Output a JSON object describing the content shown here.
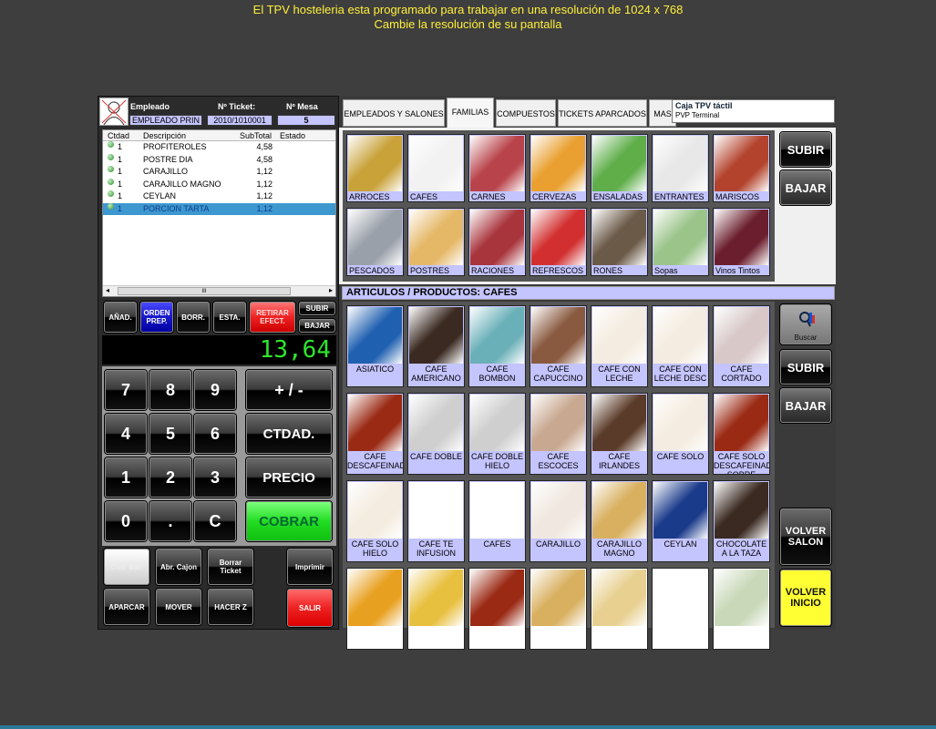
{
  "warning": {
    "line1": "El TPV hosteleria esta programado para trabajar en una resolución de 1024 x 768",
    "line2": "Cambie la resolución de su pantalla"
  },
  "header": {
    "employee_label": "Empleado",
    "employee_value": "EMPLEADO PRIN",
    "ticket_label": "Nº Ticket:",
    "ticket_value": "2010/1010001",
    "table_label": "Nº Mesa",
    "table_value": "5"
  },
  "ticket": {
    "columns": [
      "Ctdad",
      "Descripción",
      "SubTotal",
      "Estado"
    ],
    "rows": [
      {
        "qty": "1",
        "desc": "PROFITEROLES",
        "sub": "4,58"
      },
      {
        "qty": "1",
        "desc": "POSTRE DIA",
        "sub": "4,58"
      },
      {
        "qty": "1",
        "desc": "CARAJILLO",
        "sub": "1,12"
      },
      {
        "qty": "1",
        "desc": "CARAJILLO MAGNO",
        "sub": "1,12"
      },
      {
        "qty": "1",
        "desc": "CEYLAN",
        "sub": "1,12"
      },
      {
        "qty": "1",
        "desc": "PORCION TARTA",
        "sub": "1,12",
        "selected": true
      }
    ],
    "scroll_grip": "III"
  },
  "actions": {
    "add": "AÑAD.",
    "order": "ORDEN PREP.",
    "del": "BORR.",
    "state": "ESTA.",
    "withdraw": "RETIRAR EFECT.",
    "up": "SUBIR",
    "down": "BAJAR"
  },
  "total": "13,64",
  "keypad": {
    "keys": [
      "7",
      "8",
      "9",
      "4",
      "5",
      "6",
      "1",
      "2",
      "3",
      "0",
      ".",
      "C"
    ],
    "plusminus": "+ / -",
    "qty": "CTDAD.",
    "price": "PRECIO",
    "charge": "COBRAR"
  },
  "bottom": {
    "barcode": "Cod. Bar.",
    "drawer": "Abr. Cajon",
    "delete_ticket": "Borrar Ticket",
    "print": "Imprimir",
    "park": "APARCAR",
    "move": "MOVER",
    "z": "HACER Z",
    "exit": "SALIR"
  },
  "tabs": [
    "EMPLEADOS Y SALONES",
    "FAMILIAS",
    "COMPUESTOS",
    "TICKETS APARCADOS",
    "MAS"
  ],
  "active_tab": "FAMILIAS",
  "terminal": {
    "title": "Caja TPV táctil",
    "subtitle": "PVP Terminal"
  },
  "families": [
    "ARROCES",
    "CAFES",
    "CARNES",
    "CERVEZAS",
    "ENSALADAS",
    "ENTRANTES",
    "MARISCOS",
    "PESCADOS",
    "POSTRES",
    "RACIONES",
    "REFRESCOS",
    "RONES",
    "Sopas",
    "Vinos Tintos"
  ],
  "family_nav": {
    "up": "SUBIR",
    "down": "BAJAR"
  },
  "articles_header": "ARTICULOS / PRODUCTOS: CAFES",
  "articles": [
    "ASIATICO",
    "CAFE AMERICANO",
    "CAFE BOMBON",
    "CAFE CAPUCCINO",
    "CAFE CON LECHE",
    "CAFE CON LECHE DESC",
    "CAFE CORTADO",
    "CAFE DESCAFEINADO",
    "CAFE DOBLE",
    "CAFE DOBLE HIELO",
    "CAFE ESCOCES",
    "CAFE IRLANDES",
    "CAFE SOLO",
    "CAFE SOLO DESCAFEINADO SOBRE",
    "CAFE SOLO HIELO",
    "CAFE TE INFUSION",
    "CAFES",
    "CARAJILLO",
    "CARAJILLO MAGNO",
    "CEYLAN",
    "CHOCOLATE A LA TAZA",
    "",
    "",
    "",
    "",
    "",
    "",
    ""
  ],
  "article_nav": {
    "search": "Buscar",
    "up": "SUBIR",
    "down": "BAJAR",
    "back_room": "VOLVER SALON",
    "back_home": "VOLVER INICIO"
  },
  "colors": {
    "label_bg": "#c4c4ff",
    "charge": "#22dd22",
    "exit": "#ee2222",
    "order": "#1818c8",
    "home": "#ffff33",
    "display": "#2ee62e"
  }
}
